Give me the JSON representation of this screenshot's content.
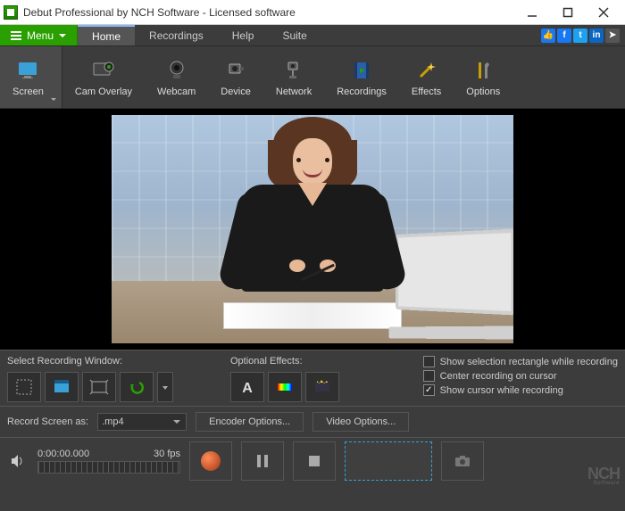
{
  "window": {
    "title": "Debut Professional by NCH Software - Licensed software"
  },
  "menubar": {
    "menu_label": "Menu",
    "tabs": [
      "Home",
      "Recordings",
      "Help",
      "Suite"
    ],
    "active_tab": "Home"
  },
  "ribbon": [
    {
      "name": "screen",
      "label": "Screen"
    },
    {
      "name": "cam-overlay",
      "label": "Cam Overlay"
    },
    {
      "name": "webcam",
      "label": "Webcam"
    },
    {
      "name": "device",
      "label": "Device"
    },
    {
      "name": "network",
      "label": "Network"
    },
    {
      "name": "recordings",
      "label": "Recordings"
    },
    {
      "name": "effects",
      "label": "Effects"
    },
    {
      "name": "options",
      "label": "Options"
    }
  ],
  "midpanel": {
    "select_window_label": "Select Recording Window:",
    "optional_effects_label": "Optional Effects:",
    "checkboxes": [
      {
        "label": "Show selection rectangle while recording",
        "checked": false
      },
      {
        "label": "Center recording on cursor",
        "checked": false
      },
      {
        "label": "Show cursor while recording",
        "checked": true
      }
    ]
  },
  "lowpanel": {
    "record_as_label": "Record Screen as:",
    "format": ".mp4",
    "encoder_btn": "Encoder Options...",
    "video_btn": "Video Options..."
  },
  "transport": {
    "time": "0:00:00.000",
    "fps": "30 fps"
  },
  "branding": {
    "logo_main": "NCH",
    "logo_sub": "Software"
  }
}
